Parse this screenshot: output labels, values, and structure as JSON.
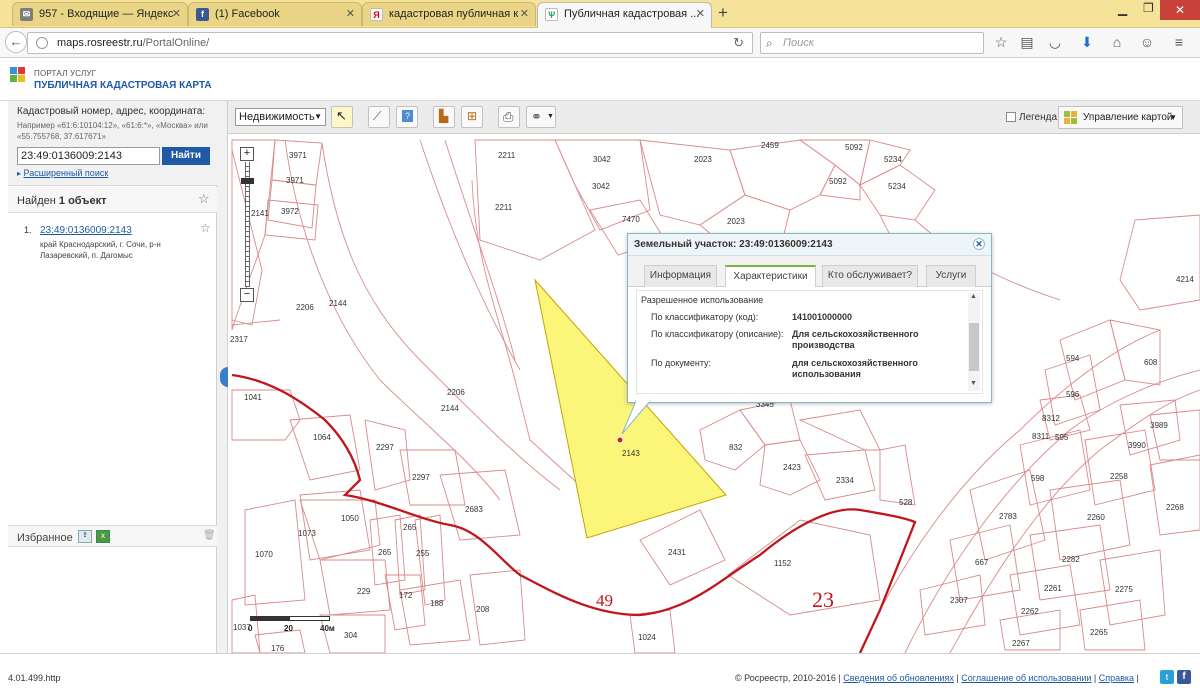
{
  "browser": {
    "tabs": [
      {
        "label": "957 - Входящие — Яндекс",
        "icon": "mail-icon"
      },
      {
        "label": "(1) Facebook",
        "icon": "facebook-icon"
      },
      {
        "label": "кадастровая публичная к",
        "icon": "yandex-icon"
      },
      {
        "label": "Публичная кадастровая ...",
        "icon": "rosreestr-icon"
      }
    ],
    "url_domain": "maps.rosreestr.ru",
    "url_path": "/PortalOnline/",
    "search_placeholder": "Поиск"
  },
  "portal": {
    "line1": "ПОРТАЛ УСЛУГ",
    "line2": "ПУБЛИЧНАЯ КАДАСТРОВАЯ КАРТА"
  },
  "search": {
    "label": "Кадастровый номер, адрес, координата:",
    "example": "Например «61:6:10104:12», «61:6:*», «Москва» или «55.755768, 37.617671»",
    "value": "23:49:0136009:2143",
    "button": "Найти",
    "advanced": "Расширенный поиск"
  },
  "results": {
    "found_prefix": "Найден",
    "found_count": "1 объект",
    "items": [
      {
        "num": "1.",
        "cadnum": "23:49:0136009:2143",
        "address": "край Краснодарский, г. Сочи, р-н Лазаревский, п. Дагомыс"
      }
    ]
  },
  "favorites": {
    "label": "Избранное"
  },
  "toolbar": {
    "layer_select": "Недвижимость",
    "legend_label": "Легенда",
    "manage_label": "Управление картой"
  },
  "popup": {
    "title": "Земельный участок: 23:49:0136009:2143",
    "tabs": [
      "Информация",
      "Характеристики",
      "Кто обслуживает?",
      "Услуги"
    ],
    "active_tab": "Характеристики",
    "section": "Разрешенное использование",
    "rows": [
      {
        "label": "По классификатору (код):",
        "value": "141001000000"
      },
      {
        "label": "По классификатору (описание):",
        "value": "Для сельскохозяйственного производства"
      },
      {
        "label": "По документу:",
        "value": "для сельскохозяйственного использования"
      }
    ]
  },
  "map": {
    "scale_labels": [
      "0",
      "20",
      "40м"
    ],
    "zone_labels": [
      "49",
      "23"
    ],
    "parcel_labels": [
      "3971",
      "3971",
      "3972",
      "2211",
      "2211",
      "3042",
      "3042",
      "2023",
      "2459",
      "5092",
      "5092",
      "5234",
      "5234",
      "7470",
      "2023",
      "4214",
      "2206",
      "2144",
      "2206",
      "2144",
      "1041",
      "1064",
      "2297",
      "2297",
      "2683",
      "1050",
      "1073",
      "1070",
      "265",
      "265",
      "255",
      "229",
      "172",
      "188",
      "208",
      "304",
      "1037",
      "176",
      "2143",
      "832",
      "3345",
      "2423",
      "2334",
      "528",
      "2431",
      "1152",
      "594",
      "608",
      "596",
      "8312",
      "8311",
      "595",
      "3989",
      "3990",
      "598",
      "2258",
      "2268",
      "2783",
      "2260",
      "667",
      "2282",
      "2307",
      "2261",
      "2275",
      "2262",
      "2265",
      "2267",
      "1024",
      "2141",
      "2317"
    ],
    "selected_parcel": "2143"
  },
  "footer": {
    "version": "4.01.499.http",
    "copyright": "© Росреестр, 2010-2016",
    "links": [
      "Сведения об обновлениях",
      "Соглашение об использовании",
      "Справка"
    ]
  },
  "colors": {
    "parcel_line": "#d98a8a",
    "boundary": "#c0161c",
    "selected_fill": "#fbf57a",
    "tabbar": "#f5e39a",
    "link": "#1f5aa6",
    "button": "#1f5aa6"
  }
}
